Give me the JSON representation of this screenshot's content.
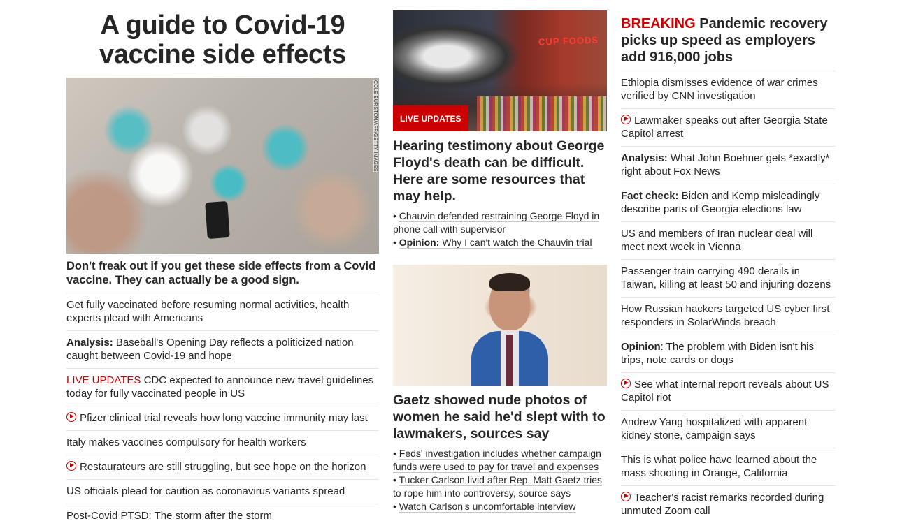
{
  "col1": {
    "title": "A guide to Covid-19 vaccine side effects",
    "photo_credit": "COLE BURSTON/AFP/GETTY IMAGES",
    "lead_headline": "Don't freak out if you get these side effects from a Covid vaccine. They can actually be a good sign.",
    "stories": [
      {
        "kicker": "",
        "text": "Get fully vaccinated before resuming normal activities, health experts plead with Americans"
      },
      {
        "kicker": "Analysis:",
        "text": " Baseball's Opening Day reflects a politicized nation caught between Covid-19 and hope"
      },
      {
        "kicker": "LIVE UPDATES",
        "text": " CDC expected to announce new travel guidelines today for fully vaccinated people in US"
      },
      {
        "video": true,
        "text": "Pfizer clinical trial reveals how long vaccine immunity may last"
      },
      {
        "kicker": "",
        "text": "Italy makes vaccines compulsory for health workers"
      },
      {
        "video": true,
        "text": "Restaurateurs are still struggling, but see hope on the horizon"
      },
      {
        "kicker": "",
        "text": "US officials plead for caution as coronavirus variants spread"
      },
      {
        "kicker": "",
        "text": "Post-Covid PTSD: The storm after the storm"
      }
    ]
  },
  "col2": {
    "story1": {
      "badge": "LIVE UPDATES",
      "sign": "CUP FOODS",
      "headline": "Hearing testimony about George Floyd's death can be difficult. Here are some resources that may help.",
      "bullets": [
        {
          "kicker": "",
          "text": "Chauvin defended restraining George Floyd in phone call with supervisor"
        },
        {
          "kicker": "Opinion:",
          "text": " Why I can't watch the Chauvin trial"
        }
      ]
    },
    "story2": {
      "headline": "Gaetz showed nude photos of women he said he'd slept with to lawmakers, sources say",
      "bullets": [
        {
          "kicker": "",
          "text": "Feds' investigation includes whether campaign funds were used to pay for travel and expenses"
        },
        {
          "kicker": "",
          "text": "Tucker Carlson livid after Rep. Matt Gaetz tries to rope him into controversy, source says"
        },
        {
          "kicker": "",
          "text": "Watch Carlson's uncomfortable interview"
        }
      ]
    }
  },
  "col3": {
    "breaking_label": "BREAKING",
    "breaking_text": " Pandemic recovery picks up speed as employers add 916,000 jobs",
    "stories": [
      {
        "kicker": "",
        "text": "Ethiopia dismisses evidence of war crimes verified by CNN investigation"
      },
      {
        "video": true,
        "text": "Lawmaker speaks out after Georgia State Capitol arrest"
      },
      {
        "kicker": "Analysis:",
        "text": " What John Boehner gets *exactly* right about Fox News"
      },
      {
        "kicker": "Fact check:",
        "text": " Biden and Kemp misleadingly describe parts of Georgia elections law"
      },
      {
        "kicker": "",
        "text": "US and members of Iran nuclear deal will meet next week in Vienna"
      },
      {
        "kicker": "",
        "text": "Passenger train carrying 490 derails in Taiwan, killing at least 50 and injuring dozens"
      },
      {
        "kicker": "",
        "text": "How Russian hackers targeted US cyber first responders in SolarWinds breach"
      },
      {
        "kicker": "Opinion",
        "text": ": The problem with Biden isn't his trips, note cards or dogs"
      },
      {
        "video": true,
        "text": "See what internal report reveals about US Capitol riot"
      },
      {
        "kicker": "",
        "text": "Andrew Yang hospitalized with apparent kidney stone, campaign says"
      },
      {
        "kicker": "",
        "text": "This is what police have learned about the mass shooting in Orange, California"
      },
      {
        "video": true,
        "text": "Teacher's racist remarks recorded during unmuted Zoom call"
      }
    ]
  },
  "colors": {
    "accent_red": "#cc0000",
    "text": "#262626",
    "divider": "#e6e6e6"
  }
}
